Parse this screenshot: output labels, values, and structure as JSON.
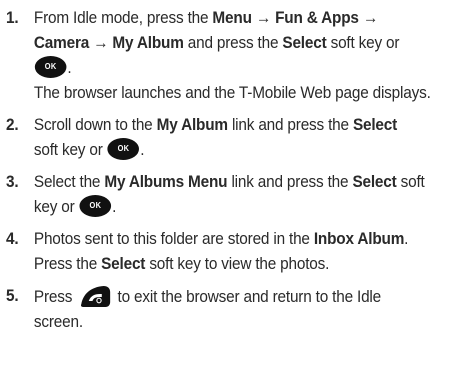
{
  "ok_key_label": "OK",
  "steps": [
    {
      "number": "1.",
      "t1": "From Idle mode, press the ",
      "b1": "Menu",
      "t2": " → ",
      "b2": "Fun & Apps",
      "t3": " →",
      "b3": "Camera",
      "t4": " → ",
      "b4": "My Album",
      "t5": " and press the ",
      "b5": "Select",
      "t6": " soft key or",
      "t7": ".",
      "note": "The browser launches and the T-Mobile Web page displays."
    },
    {
      "number": "2.",
      "t1": "Scroll down to the ",
      "b1": "My Album",
      "t2": " link and press the ",
      "b2": "Select",
      "t3": "soft key or ",
      "t4": "."
    },
    {
      "number": "3.",
      "t1": "Select the ",
      "b1": "My Albums Menu",
      "t2": " link and press the ",
      "b2": "Select",
      "t3": " soft",
      "t4": "key or ",
      "t5": "."
    },
    {
      "number": "4.",
      "t1": "Photos sent to this folder are stored in the ",
      "b1": "Inbox Album",
      "t2": ".",
      "t3": "Press the ",
      "b2": "Select",
      "t4": " soft key to view the photos."
    },
    {
      "number": "5.",
      "t1": "Press ",
      "t2": " to exit the browser and return to the Idle",
      "t3": "screen."
    }
  ]
}
